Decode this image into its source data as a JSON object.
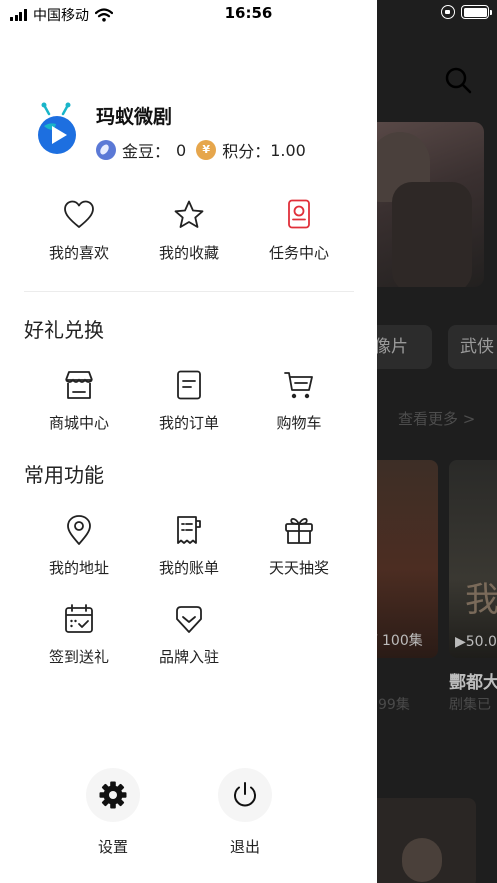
{
  "status_bar": {
    "carrier": "中国移动",
    "time": "16:56"
  },
  "profile": {
    "app_name": "玛蚁微剧",
    "beans_label": "金豆：",
    "beans_value": "0",
    "points_label": "积分：",
    "points_value": "1.00",
    "points_coin_symbol": "¥"
  },
  "quick_actions": [
    {
      "label": "我的喜欢",
      "icon": "heart-icon"
    },
    {
      "label": "我的收藏",
      "icon": "star-icon"
    },
    {
      "label": "任务中心",
      "icon": "task-icon",
      "accent": "#e0303a"
    }
  ],
  "sections": {
    "exchange": {
      "title": "好礼兑换",
      "items": [
        {
          "label": "商城中心",
          "icon": "store-icon"
        },
        {
          "label": "我的订单",
          "icon": "order-icon"
        },
        {
          "label": "购物车",
          "icon": "cart-icon"
        }
      ]
    },
    "common": {
      "title": "常用功能",
      "items": [
        {
          "label": "我的地址",
          "icon": "location-icon"
        },
        {
          "label": "我的账单",
          "icon": "bill-icon"
        },
        {
          "label": "天天抽奖",
          "icon": "gift-icon"
        },
        {
          "label": "签到送礼",
          "icon": "calendar-check-icon"
        },
        {
          "label": "品牌入驻",
          "icon": "brand-icon"
        }
      ]
    }
  },
  "bottom": {
    "settings": "设置",
    "logout": "退出"
  },
  "background": {
    "chip_1": "像片",
    "chip_2": "武侠",
    "see_more": "查看更多 >",
    "card_1_episodes": "V 100集",
    "card_2_episodes": "▶50.0",
    "card_2_calligraphy": "我",
    "card_2_title": "酆都大",
    "card_1_sub": "99集",
    "card_2_sub": "剧集已"
  },
  "colors": {
    "accent_red": "#e0303a",
    "logo_blue": "#1d6fe0",
    "logo_teal": "#19b5c9"
  }
}
